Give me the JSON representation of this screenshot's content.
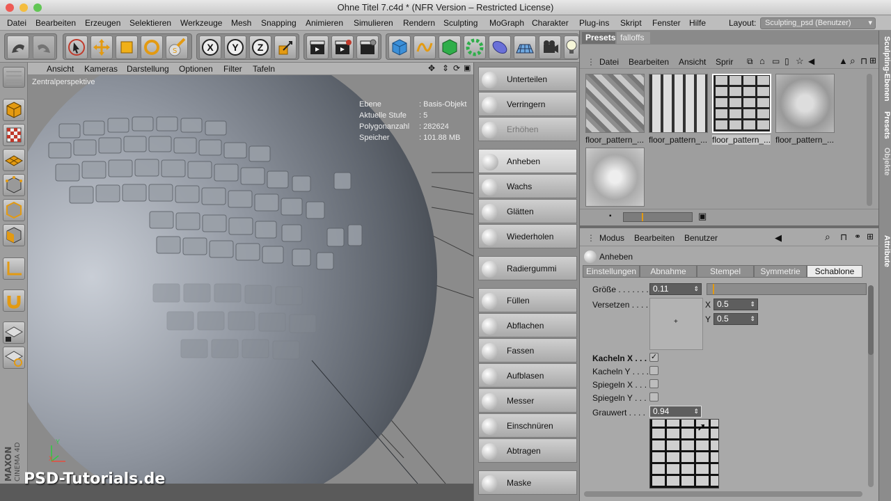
{
  "window": {
    "title": "Ohne Titel 7.c4d * (NFR Version – Restricted License)"
  },
  "menu": [
    "Datei",
    "Bearbeiten",
    "Erzeugen",
    "Selektieren",
    "Werkzeuge",
    "Mesh",
    "Snapping",
    "Animieren",
    "Simulieren",
    "Rendern",
    "Sculpting",
    "MoGraph",
    "Charakter",
    "Plug-ins",
    "Skript",
    "Fenster",
    "Hilfe"
  ],
  "layout": {
    "label": "Layout:",
    "value": "Sculpting_psd (Benutzer)"
  },
  "axis_buttons": [
    "X",
    "Y",
    "Z"
  ],
  "viewport": {
    "menu": [
      "Ansicht",
      "Kameras",
      "Darstellung",
      "Optionen",
      "Filter",
      "Tafeln"
    ],
    "label": "Zentralperspektive",
    "info": [
      {
        "k": "Ebene",
        "v": "Basis-Objekt"
      },
      {
        "k": "Aktuelle Stufe",
        "v": "5"
      },
      {
        "k": "Polygonanzahl",
        "v": "282624"
      },
      {
        "k": "Speicher",
        "v": "101.88 MB"
      }
    ]
  },
  "sculpt_tools": [
    {
      "label": "Unterteilen",
      "state": "normal"
    },
    {
      "label": "Verringern",
      "state": "normal"
    },
    {
      "label": "Erhöhen",
      "state": "disabled"
    },
    {
      "label": "Anheben",
      "state": "active"
    },
    {
      "label": "Wachs",
      "state": "normal"
    },
    {
      "label": "Glätten",
      "state": "normal"
    },
    {
      "label": "Wiederholen",
      "state": "normal"
    },
    {
      "label": "Radiergummi",
      "state": "normal"
    },
    {
      "label": "Füllen",
      "state": "normal"
    },
    {
      "label": "Abflachen",
      "state": "normal"
    },
    {
      "label": "Fassen",
      "state": "normal"
    },
    {
      "label": "Aufblasen",
      "state": "normal"
    },
    {
      "label": "Messer",
      "state": "normal"
    },
    {
      "label": "Einschnüren",
      "state": "normal"
    },
    {
      "label": "Abtragen",
      "state": "normal"
    },
    {
      "label": "Maske",
      "state": "normal"
    }
  ],
  "presets": {
    "tabs": [
      "Presets",
      "falloffs"
    ],
    "menu": [
      "Datei",
      "Bearbeiten",
      "Ansicht",
      "Sprir"
    ],
    "thumbs": [
      "floor_pattern_...",
      "floor_pattern_...",
      "floor_pattern_...",
      "floor_pattern_..."
    ]
  },
  "side_tabs": [
    "Sculpting-Ebenen",
    "Presets",
    "Objekte",
    "Attribute"
  ],
  "attributes": {
    "menu": [
      "Modus",
      "Bearbeiten",
      "Benutzer"
    ],
    "tool": "Anheben",
    "tabs": [
      "Einstellungen",
      "Abnahme",
      "Stempel",
      "Symmetrie",
      "Schablone"
    ],
    "selected_tab": "Schablone",
    "groesse": {
      "label": "Größe . . . . . . .",
      "value": "0.11",
      "slider_fraction": 0.11
    },
    "versetzen": {
      "label": "Versetzen . . . .",
      "x_label": "X",
      "x": "0.5",
      "y_label": "Y",
      "y": "0.5"
    },
    "checks": [
      {
        "label": "Kacheln X . . .",
        "checked": true
      },
      {
        "label": "Kacheln Y . . . .",
        "checked": false
      },
      {
        "label": "Spiegeln X . . .",
        "checked": false
      },
      {
        "label": "Spiegeln Y . . .",
        "checked": false
      }
    ],
    "grauwert": {
      "label": "Grauwert . . . .",
      "value": "0.94"
    }
  },
  "branding": {
    "watermark": "PSD-Tutorials.de",
    "maxon": "MAXON",
    "c4d": "CINEMA 4D"
  },
  "axis_gizmo": {
    "y": "Y",
    "x": "X"
  }
}
